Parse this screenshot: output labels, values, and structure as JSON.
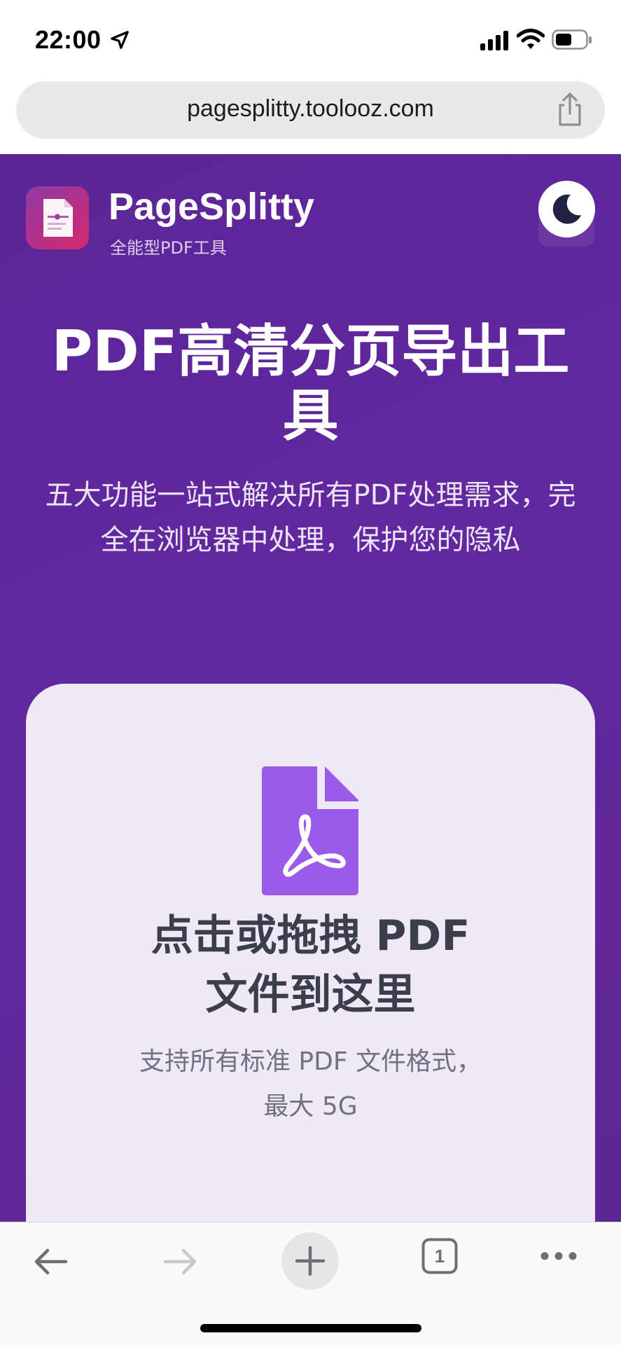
{
  "status_bar": {
    "time": "22:00",
    "icons": [
      "location-arrow-icon",
      "cellular-signal-icon",
      "wifi-icon",
      "battery-icon"
    ]
  },
  "browser": {
    "url": "pagesplitty.toolooz.com",
    "share_icon": "share-icon"
  },
  "header": {
    "brand_name": "PageSplitty",
    "brand_subtitle": "全能型PDF工具",
    "theme_toggle_icon": "moon-icon"
  },
  "hero": {
    "title": "PDF高清分页导出工具",
    "subtitle": "五大功能一站式解决所有PDF处理需求，完全在浏览器中处理，保护您的隐私"
  },
  "upload": {
    "title_line1": "点击或拖拽 PDF",
    "title_line2": "文件到这里",
    "hint_line1": "支持所有标准 PDF 文件格式，",
    "hint_line2": "最大 5G"
  },
  "toolbar": {
    "tab_count": "1",
    "icons": [
      "back-arrow-icon",
      "forward-arrow-icon",
      "plus-icon",
      "tabs-icon",
      "more-icon"
    ]
  },
  "colors": {
    "page_purple": "#5e2597",
    "card_background": "#efe8f5",
    "pdf_icon_purple": "#9b5ae8",
    "logo_gradient_start": "#8e3aa6",
    "logo_gradient_end": "#d6296d"
  }
}
